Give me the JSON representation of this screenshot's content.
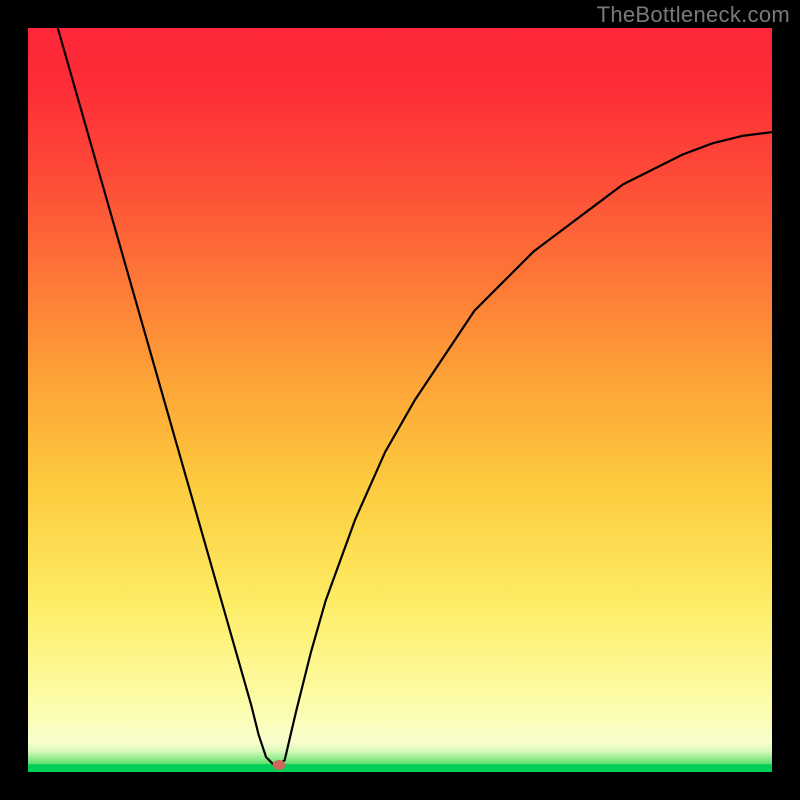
{
  "watermark": "TheBottleneck.com",
  "chart_data": {
    "type": "line",
    "title": "",
    "xlabel": "",
    "ylabel": "",
    "xlim": [
      0,
      100
    ],
    "ylim": [
      0,
      100
    ],
    "grid": false,
    "legend": false,
    "series": [
      {
        "name": "bottleneck-curve",
        "x": [
          4,
          6,
          8,
          10,
          12,
          14,
          16,
          18,
          20,
          22,
          24,
          26,
          28,
          30,
          31,
          32,
          33,
          33.8,
          34.5,
          36,
          38,
          40,
          44,
          48,
          52,
          56,
          60,
          64,
          68,
          72,
          76,
          80,
          84,
          88,
          92,
          96,
          100
        ],
        "y": [
          100,
          93,
          86,
          79,
          72,
          65,
          58,
          51,
          44,
          37,
          30,
          23,
          16,
          9,
          5,
          2,
          1,
          1,
          1.6,
          8,
          16,
          23,
          34,
          43,
          50,
          56,
          62,
          66,
          70,
          73,
          76,
          79,
          81,
          83,
          84.5,
          85.5,
          86
        ]
      }
    ],
    "marker": {
      "x": 33.8,
      "y": 1,
      "color": "#cb6a59"
    },
    "background_gradient": {
      "stops": [
        {
          "pos": 0.0,
          "color": "#fd263a"
        },
        {
          "pos": 0.34,
          "color": "#fd7837"
        },
        {
          "pos": 0.62,
          "color": "#fdcc3f"
        },
        {
          "pos": 0.9,
          "color": "#fdfca5"
        },
        {
          "pos": 0.97,
          "color": "#d7fab9"
        },
        {
          "pos": 0.99,
          "color": "#00d05a"
        },
        {
          "pos": 1.0,
          "color": "#00d05a"
        }
      ]
    }
  }
}
